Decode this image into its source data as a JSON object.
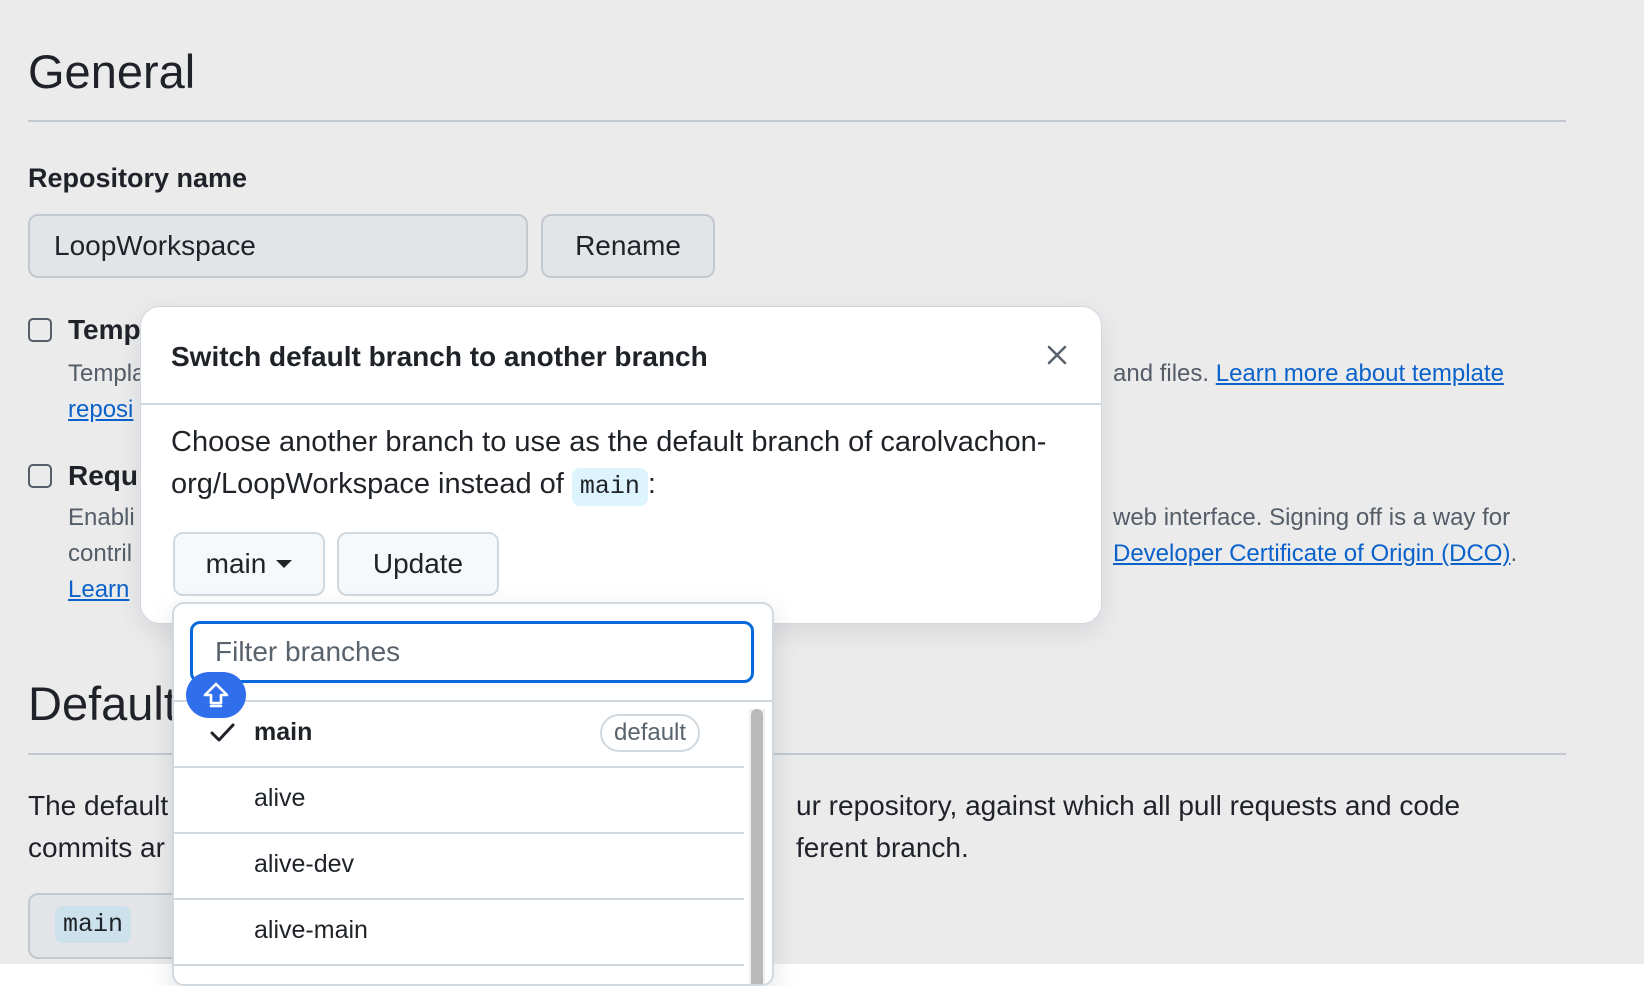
{
  "settings": {
    "general_heading": "General",
    "repo_name_label": "Repository name",
    "repo_name_value": "LoopWorkspace",
    "rename_button": "Rename",
    "template": {
      "title_partial": "Temp",
      "desc_partial": "Templa",
      "desc_right": "and files.",
      "link_right": "Learn more about template",
      "link_partial": "reposi"
    },
    "signoff": {
      "title_partial": "Requ",
      "desc_partial_1": "Enabli",
      "desc_right_1": "web interface. Signing off is a way for",
      "desc_partial_2": "contril",
      "link_right_2": "Developer Certificate of Origin (DCO)",
      "desc_right_2_end": ".",
      "link_partial_3": "Learn"
    },
    "default_heading_partial": "Default",
    "default_desc_1_left": "The default",
    "default_desc_1_right": "ur repository, against which all pull requests and code",
    "default_desc_2_left": "commits ar",
    "default_desc_2_right": "ferent branch.",
    "current_branch_code": "main"
  },
  "dialog": {
    "title": "Switch default branch to another branch",
    "close_icon": "close-icon",
    "text_1": "Choose another branch to use as the default branch of carolvachon-",
    "text_2": "org/LoopWorkspace instead of",
    "current_branch": "main",
    "text_colon": ":",
    "branch_select_label": "main",
    "update_button": "Update"
  },
  "branch_menu": {
    "filter_placeholder": "Filter branches",
    "items": [
      {
        "name": "main",
        "selected": true,
        "badge": "default"
      },
      {
        "name": "alive"
      },
      {
        "name": "alive-dev"
      },
      {
        "name": "alive-main"
      }
    ]
  },
  "colors": {
    "accent": "#0969da",
    "border": "#d1d9e0",
    "muted_text": "#59636e",
    "code_bg": "#ddf4ff"
  }
}
